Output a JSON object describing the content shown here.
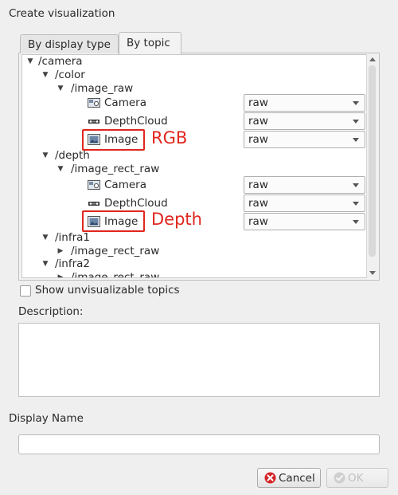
{
  "window": {
    "title": "Create visualization"
  },
  "tabs": [
    {
      "label": "By display type",
      "selected": false
    },
    {
      "label": "By topic",
      "selected": true
    }
  ],
  "tree": {
    "rows": [
      {
        "label": "/camera",
        "expander": "expanded"
      },
      {
        "label": "/color",
        "expander": "expanded"
      },
      {
        "label": "/image_raw",
        "expander": "expanded"
      },
      {
        "label": "Camera",
        "icon": "camera-icon",
        "combo": "raw"
      },
      {
        "label": "DepthCloud",
        "icon": "depthcloud-icon",
        "combo": "raw"
      },
      {
        "label": "Image",
        "icon": "image-icon",
        "combo": "raw"
      },
      {
        "label": "/depth",
        "expander": "expanded"
      },
      {
        "label": "/image_rect_raw",
        "expander": "expanded"
      },
      {
        "label": "Camera",
        "icon": "camera-icon",
        "combo": "raw"
      },
      {
        "label": "DepthCloud",
        "icon": "depthcloud-icon",
        "combo": "raw"
      },
      {
        "label": "Image",
        "icon": "image-icon",
        "combo": "raw"
      },
      {
        "label": "/infra1",
        "expander": "expanded"
      },
      {
        "label": "/image_rect_raw",
        "expander": "collapsed"
      },
      {
        "label": "/infra2",
        "expander": "expanded"
      },
      {
        "label": "/image_rect_raw",
        "expander": "collapsed"
      }
    ]
  },
  "annotations": {
    "rgb": "RGB",
    "depth": "Depth",
    "color": "#e0261e"
  },
  "show_unvisualizable": {
    "label": "Show unvisualizable topics",
    "checked": false
  },
  "description": {
    "label": "Description:",
    "value": ""
  },
  "display_name": {
    "label": "Display Name",
    "value": ""
  },
  "buttons": {
    "cancel": {
      "label": "Cancel",
      "icon": "cancel-icon"
    },
    "ok": {
      "label": "OK",
      "icon": "ok-icon",
      "enabled": false
    }
  }
}
